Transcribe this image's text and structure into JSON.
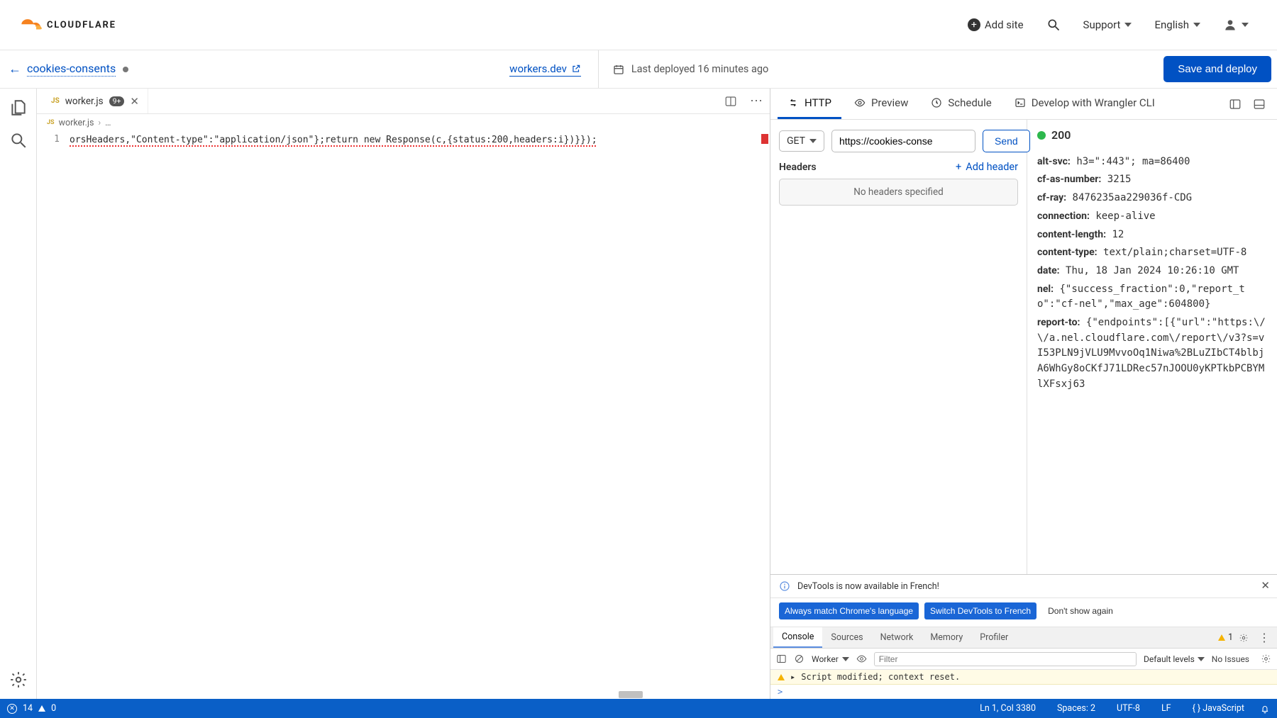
{
  "topnav": {
    "brand": "CLOUDFLARE",
    "add_site": "Add site",
    "support": "Support",
    "language": "English"
  },
  "subhead": {
    "project_name": "cookies-consents",
    "workers_link": "workers.dev",
    "last_deployed": "Last deployed 16 minutes ago",
    "deploy_button": "Save and deploy"
  },
  "editor": {
    "tab_file": "worker.js",
    "tab_modified_badge": "9+",
    "breadcrumb_file": "worker.js",
    "breadcrumb_rest": "…",
    "line_number": "1",
    "code_line": "orsHeaders,\"Content-type\":\"application/json\"};return new Response(c,{status:200,headers:i})}});"
  },
  "http": {
    "tabs": {
      "http": "HTTP",
      "preview": "Preview",
      "schedule": "Schedule",
      "wrangler": "Develop with Wrangler CLI"
    },
    "method": "GET",
    "url": "https://cookies-conse",
    "send": "Send",
    "status_code": "200",
    "headers_label": "Headers",
    "add_header": "Add header",
    "no_headers": "No headers specified",
    "response_headers": [
      {
        "k": "alt-svc:",
        "v": "h3=\":443\"; ma=86400"
      },
      {
        "k": "cf-as-number:",
        "v": "3215"
      },
      {
        "k": "cf-ray:",
        "v": "8476235aa229036f-CDG"
      },
      {
        "k": "connection:",
        "v": "keep-alive"
      },
      {
        "k": "content-length:",
        "v": "12"
      },
      {
        "k": "content-type:",
        "v": "text/plain;charset=UTF-8"
      },
      {
        "k": "date:",
        "v": "Thu, 18 Jan 2024 10:26:10 GMT"
      },
      {
        "k": "nel:",
        "v": "{\"success_fraction\":0,\"report_to\":\"cf-nel\",\"max_age\":604800}"
      },
      {
        "k": "report-to:",
        "v": "{\"endpoints\":[{\"url\":\"https:\\/\\/a.nel.cloudflare.com\\/report\\/v3?s=vI53PLN9jVLU9MvvoOq1Niwa%2BLuZIbCT4blbjA6WhGy8oCKfJ71LDRec57nJOOU0yKPTkbPCBYMlXFsxj63"
      }
    ]
  },
  "devtools": {
    "banner": "DevTools is now available in French!",
    "btn_always": "Always match Chrome's language",
    "btn_switch": "Switch DevTools to French",
    "btn_dont": "Don't show again",
    "tabs": {
      "console": "Console",
      "sources": "Sources",
      "network": "Network",
      "memory": "Memory",
      "profiler": "Profiler"
    },
    "warn_count": "1",
    "context": "Worker",
    "filter_placeholder": "Filter",
    "levels": "Default levels",
    "no_issues": "No Issues",
    "warn_line": "Script modified; context reset.",
    "prompt": ">"
  },
  "statusbar": {
    "error_count": "14",
    "warn_count": "0",
    "cursor": "Ln 1, Col 3380",
    "spaces": "Spaces: 2",
    "encoding": "UTF-8",
    "eol": "LF",
    "lang": "JavaScript"
  }
}
